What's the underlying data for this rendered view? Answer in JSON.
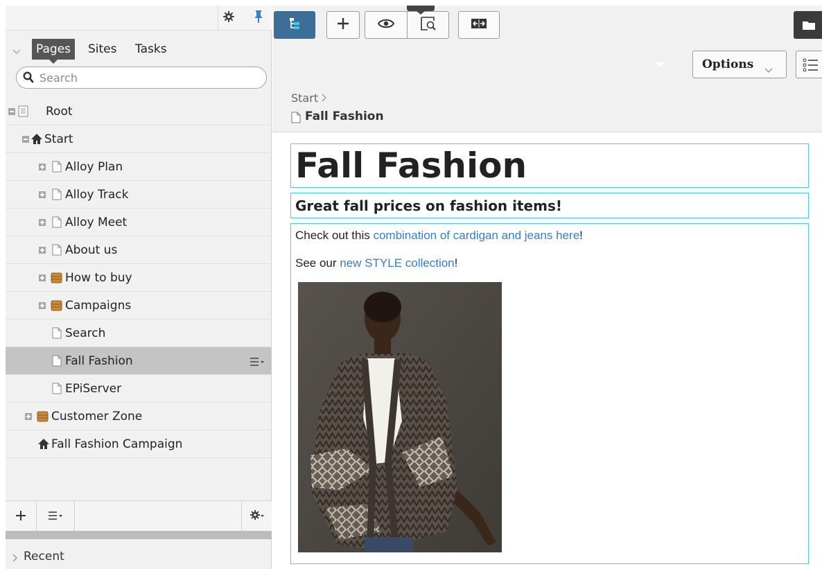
{
  "nav": {
    "tabs": [
      {
        "label": "Pages",
        "active": true
      },
      {
        "label": "Sites",
        "active": false
      },
      {
        "label": "Tasks",
        "active": false
      }
    ],
    "search": {
      "placeholder": "Search",
      "value": ""
    },
    "tree": [
      {
        "label": "Root",
        "icon": "root-page-icon",
        "toggle": "minus"
      },
      {
        "label": "Start",
        "icon": "home-icon",
        "toggle": "minus"
      },
      {
        "label": "Alloy Plan",
        "icon": "page-icon",
        "toggle": "plus"
      },
      {
        "label": "Alloy Track",
        "icon": "page-icon",
        "toggle": "plus"
      },
      {
        "label": "Alloy Meet",
        "icon": "page-icon",
        "toggle": "plus"
      },
      {
        "label": "About us",
        "icon": "page-icon",
        "toggle": "plus"
      },
      {
        "label": "How to buy",
        "icon": "container-icon",
        "toggle": "plus"
      },
      {
        "label": "Campaigns",
        "icon": "container-icon",
        "toggle": "plus"
      },
      {
        "label": "Search",
        "icon": "page-icon",
        "toggle": "none"
      },
      {
        "label": "Fall Fashion",
        "icon": "page-icon",
        "toggle": "none",
        "selected": true
      },
      {
        "label": "EPiServer",
        "icon": "page-icon",
        "toggle": "none"
      },
      {
        "label": "Customer Zone",
        "icon": "container-icon",
        "toggle": "plus"
      },
      {
        "label": "Fall Fashion Campaign",
        "icon": "home-icon",
        "toggle": "none"
      }
    ],
    "recent_label": "Recent"
  },
  "toolbar": {
    "options_label": "Options"
  },
  "header": {
    "breadcrumb": "Start",
    "page_name": "Fall Fashion"
  },
  "content": {
    "heading": "Fall Fashion",
    "subheading": "Great fall prices on fashion items!",
    "p1_prefix": "Check out this ",
    "p1_link": "combination of cardigan and jeans here",
    "p1_suffix": "!",
    "p2_prefix": "See our ",
    "p2_link": "new  STYLE collection",
    "p2_suffix": "!"
  },
  "colors": {
    "accent": "#3d6f96",
    "link": "#3a7cc2",
    "block_outline": "#4fc8ee",
    "selected_row": "#c4c4c4"
  }
}
